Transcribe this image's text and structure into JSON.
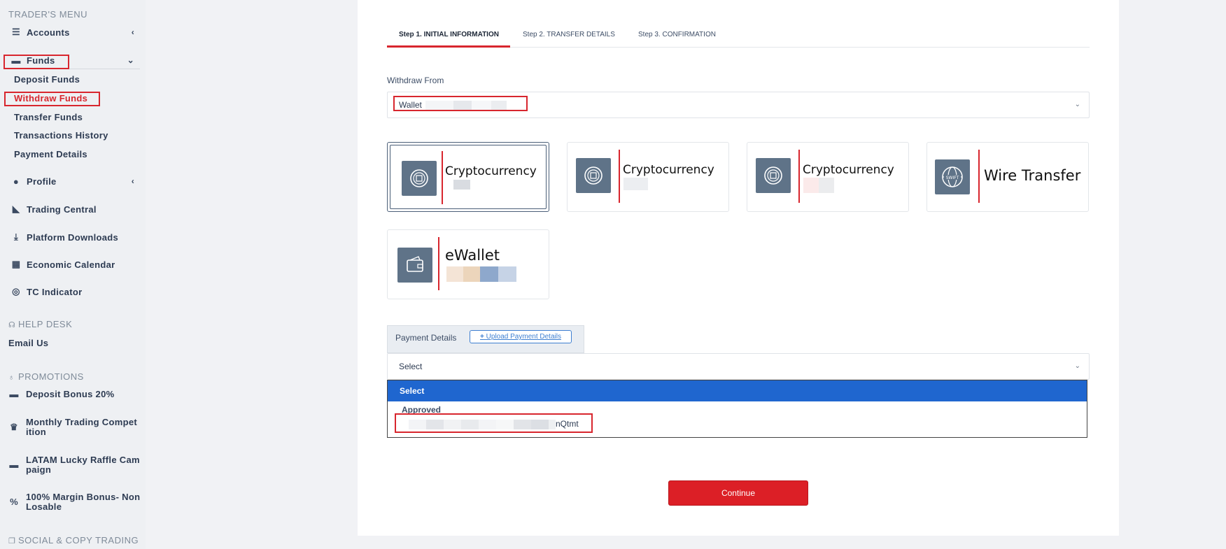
{
  "sidebar": {
    "traders_menu_title": "TRADER'S MENU",
    "accounts": "Accounts",
    "funds": "Funds",
    "funds_sub": [
      "Deposit Funds",
      "Withdraw Funds",
      "Transfer Funds",
      "Transactions History",
      "Payment Details"
    ],
    "profile": "Profile",
    "trading_central": "Trading Central",
    "platform_downloads": "Platform Downloads",
    "economic_calendar": "Economic Calendar",
    "tc_indicator": "TC Indicator",
    "help_desk_title": "HELP DESK",
    "email_us": "Email Us",
    "promotions_title": "PROMOTIONS",
    "promotions": [
      {
        "label": "Deposit Bonus 20%",
        "icon": "wallet-icon"
      },
      {
        "label": "Monthly Trading Compet ition",
        "icon": "trophy-icon"
      },
      {
        "label": "LATAM Lucky Raffle Cam paign",
        "icon": "wallet-icon"
      },
      {
        "label": "100% Margin Bonus- Non Losable",
        "icon": "percent-icon"
      }
    ],
    "social_title": "SOCIAL & COPY TRADING"
  },
  "tabs": [
    "Step 1. INITIAL INFORMATION",
    "Step 2. TRANSFER DETAILS",
    "Step 3. CONFIRMATION"
  ],
  "withdraw_from": {
    "label": "Withdraw From",
    "value": "Wallet"
  },
  "methods": [
    "Cryptocurrency",
    "Cryptocurrency",
    "Cryptocurrency",
    "Wire Transfer",
    "eWallet"
  ],
  "payment_details": {
    "label": "Payment Details",
    "upload_label": "Upload Payment Details",
    "select_value": "Select",
    "options": {
      "selected": "Select",
      "group": "Approved",
      "item_suffix": "nQtmt"
    }
  },
  "continue_label": "Continue",
  "colors": {
    "accent_red": "#d8262e",
    "select_blue": "#1f66cf",
    "icon_slate": "#5f7388"
  }
}
